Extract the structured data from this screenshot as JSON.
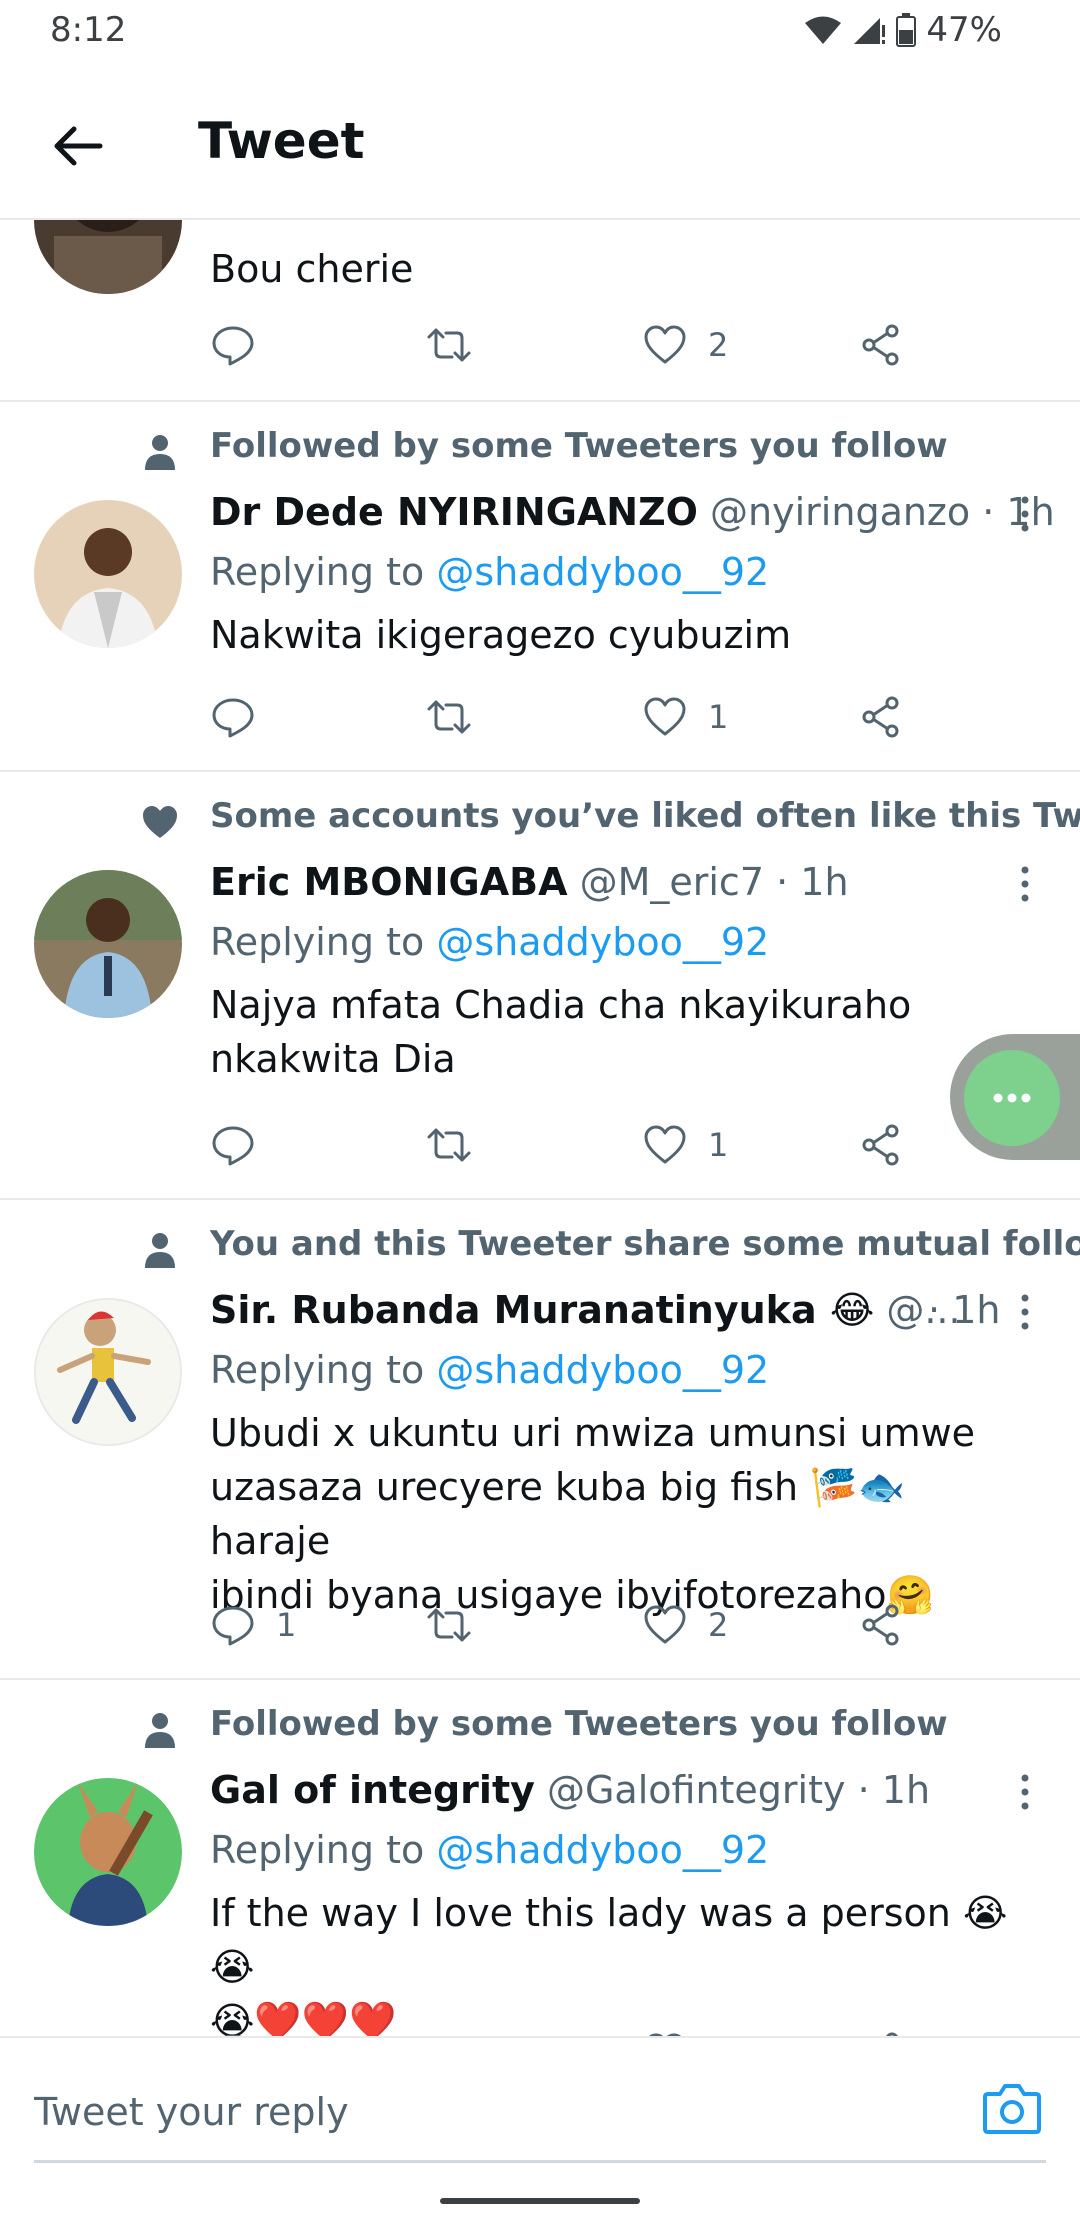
{
  "status_bar": {
    "time": "8:12",
    "battery": "47%"
  },
  "header": {
    "title": "Tweet"
  },
  "first_tweet": {
    "text": "Bou cherie",
    "like_count": "2"
  },
  "tweets": [
    {
      "social_context": "Followed by some Tweeters you follow",
      "name": "Dr Dede NYIRINGANZO",
      "handle": "@nyiringanzo",
      "dot": "·",
      "time": "1h",
      "replying_prefix": "Replying to ",
      "replying_to": "@shaddyboo__92",
      "text": "Nakwita ikigeragezo cyubuzim",
      "reply_count": "",
      "like_count": "1"
    },
    {
      "social_context": "Some accounts you’ve liked often like this Tweeter",
      "name": "Eric MBONIGABA",
      "handle": "@M_eric7",
      "dot": "·",
      "time": "1h",
      "replying_prefix": "Replying to ",
      "replying_to": "@shaddyboo__92",
      "text_line1": "Najya mfata Chadia cha nkayikuraho",
      "text_line2": "nkakwita Dia",
      "reply_count": "",
      "like_count": "1"
    },
    {
      "social_context": "You and this Tweeter share some mutual follows",
      "name": "Sir. Rubanda Muranatinyuka 😂",
      "handle": "@...",
      "dot": "·",
      "time": "1h",
      "replying_prefix": "Replying to ",
      "replying_to": "@shaddyboo__92",
      "text_line1": "Ubudi x ukuntu uri mwiza umunsi umwe",
      "text_line2": "uzasaza urecyere kuba big fish 🎏🐟 haraje",
      "text_line3": "ibindi byana usigaye ibyifotorezaho🤗",
      "reply_count": "1",
      "like_count": "2"
    },
    {
      "social_context": "Followed by some Tweeters you follow",
      "name": "Gal of integrity",
      "handle": "@Galofintegrity",
      "dot": "·",
      "time": "1h",
      "replying_prefix": "Replying to ",
      "replying_to": "@shaddyboo__92",
      "text_line1": "If the way I love this lady was a person 😭😭",
      "text_line2": "😭❤️❤️❤️"
    }
  ],
  "reply_bar": {
    "placeholder": "Tweet your reply",
    "icon": "camera-icon"
  },
  "icons": [
    "back-arrow-icon",
    "reply-icon",
    "retweet-icon",
    "like-icon",
    "share-icon",
    "more-icon",
    "person-icon",
    "heart-icon",
    "wifi-icon",
    "signal-icon",
    "battery-icon"
  ],
  "colors": {
    "accent": "#1d9bf0",
    "muted": "#536471",
    "text": "#0f1419",
    "fab": "#7ed08d"
  }
}
